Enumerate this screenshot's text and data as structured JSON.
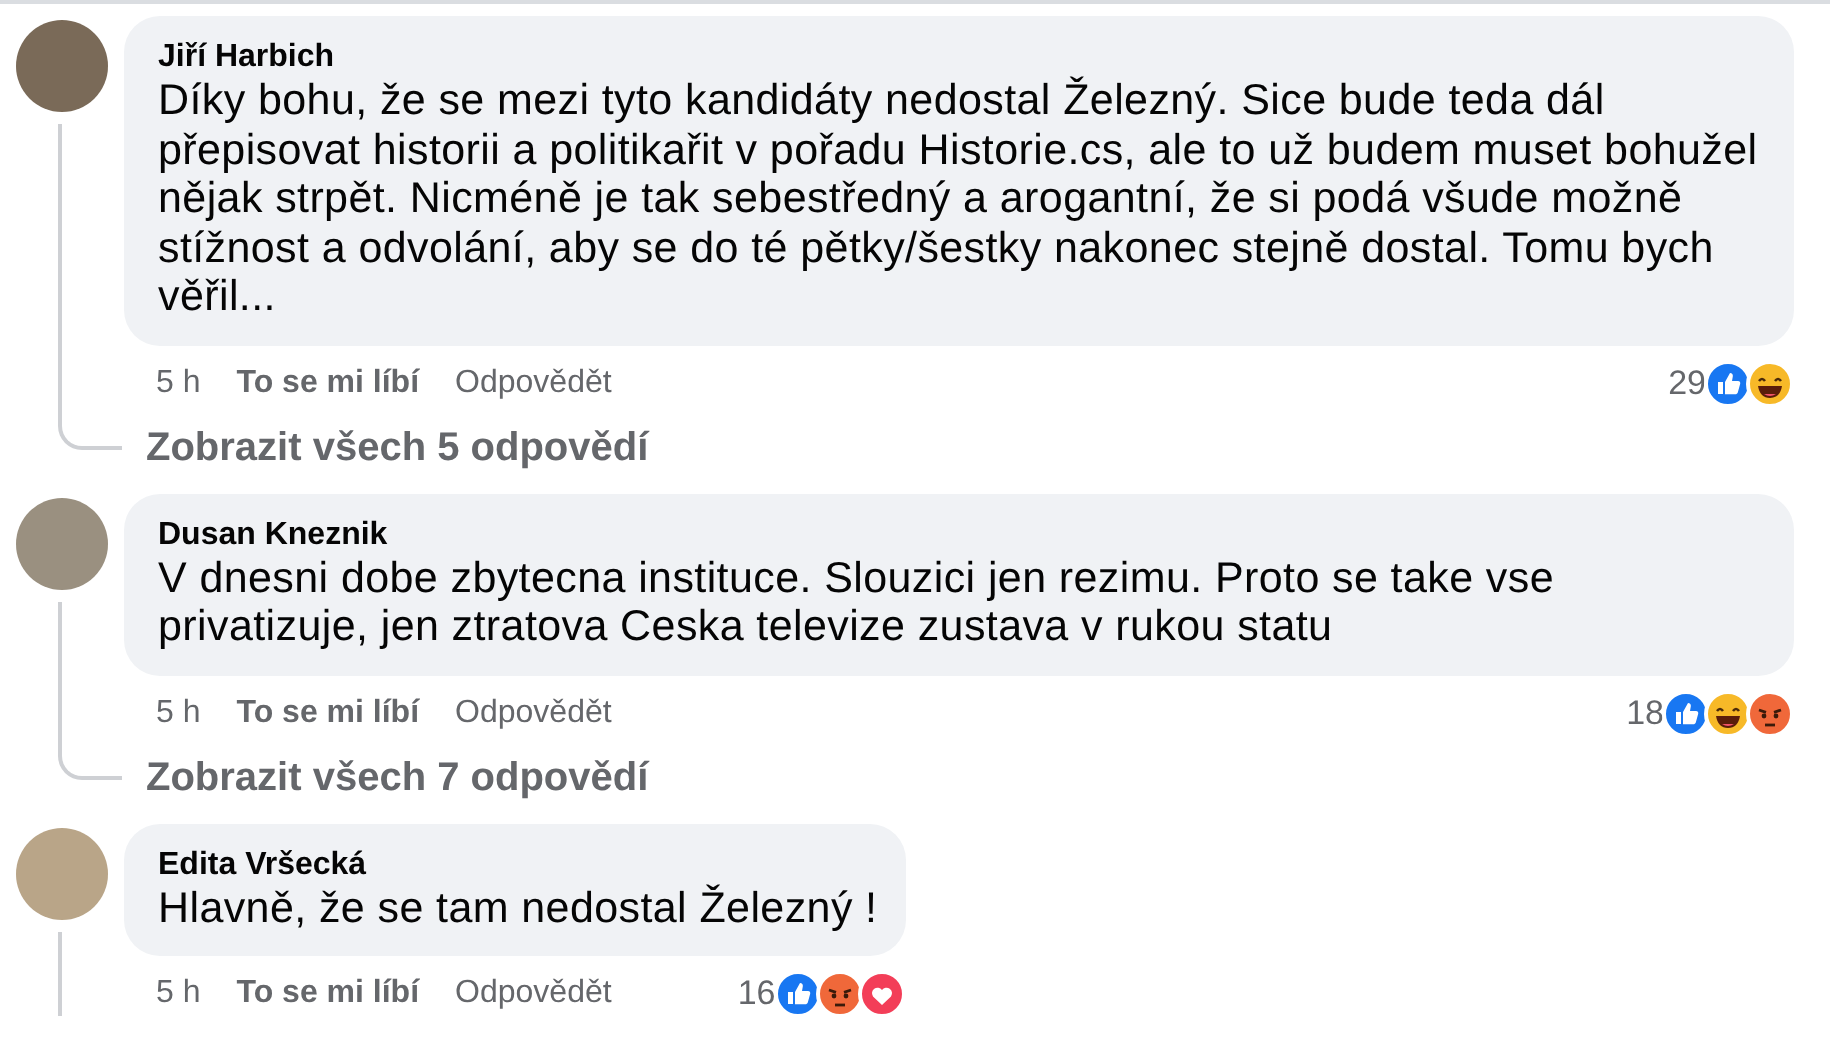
{
  "comments": [
    {
      "author": "Jiří Harbich",
      "text": "Díky bohu, že se mezi tyto kandidáty nedostal Železný. Sice bude teda dál přepisovat historii a politikařit v pořadu Historie.cs, ale to už budem muset bohužel nějak strpět. Nicméně je tak sebestředný a arogantní, že si podá všude možně stížnost a odvolání, aby se do té pětky/šestky nakonec stejně dostal. Tomu bych věřil...",
      "time": "5 h",
      "like_action": "To se mi líbí",
      "reply_action": "Odpovědět",
      "reaction_count": "29",
      "reactions": [
        {
          "kind": "like"
        },
        {
          "kind": "haha"
        }
      ],
      "thread_continues": true,
      "replies_link": "Zobrazit všech 5 odpovědí"
    },
    {
      "author": "Dusan Kneznik",
      "text": "V dnesni dobe zbytecna instituce. Slouzici jen rezimu. Proto se take vse privatizuje, jen ztratova Ceska televize zustava v rukou statu",
      "time": "5 h",
      "like_action": "To se mi líbí",
      "reply_action": "Odpovědět",
      "reaction_count": "18",
      "reactions": [
        {
          "kind": "like"
        },
        {
          "kind": "haha"
        },
        {
          "kind": "angry"
        }
      ],
      "thread_continues": true,
      "replies_link": "Zobrazit všech 7 odpovědí"
    },
    {
      "author": "Edita Vršecká",
      "text": "Hlavně, že se tam nedostal Železný !",
      "time": "5 h",
      "like_action": "To se mi líbí",
      "reply_action": "Odpovědět",
      "reaction_count": "16",
      "reactions": [
        {
          "kind": "like"
        },
        {
          "kind": "angry"
        },
        {
          "kind": "love"
        }
      ],
      "thread_continues": true
    }
  ]
}
